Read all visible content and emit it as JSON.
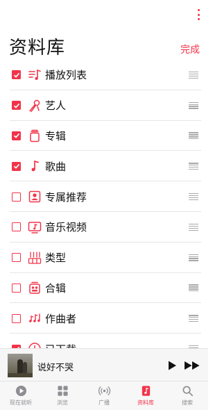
{
  "header": {
    "title": "资料库",
    "done_label": "完成",
    "more_icon": "more-vertical-icon"
  },
  "colors": {
    "accent": "#f2334a",
    "separator": "#e6e6e6",
    "handle": "#a8a8a8"
  },
  "library_items": [
    {
      "label": "播放列表",
      "checked": true,
      "icon": "playlist-icon"
    },
    {
      "label": "艺人",
      "checked": true,
      "icon": "microphone-icon"
    },
    {
      "label": "专辑",
      "checked": true,
      "icon": "album-stack-icon"
    },
    {
      "label": "歌曲",
      "checked": true,
      "icon": "music-note-icon"
    },
    {
      "label": "专属推荐",
      "checked": false,
      "icon": "person-square-icon"
    },
    {
      "label": "音乐视频",
      "checked": false,
      "icon": "tv-music-icon"
    },
    {
      "label": "类型",
      "checked": false,
      "icon": "genre-icon"
    },
    {
      "label": "合辑",
      "checked": false,
      "icon": "compilation-icon"
    },
    {
      "label": "作曲者",
      "checked": false,
      "icon": "composer-notes-icon"
    },
    {
      "label": "已下载",
      "checked": true,
      "icon": "download-circle-icon"
    }
  ],
  "now_playing": {
    "song_title": "说好不哭",
    "play_icon": "play-icon",
    "next_icon": "forward-icon"
  },
  "tabs": [
    {
      "label": "现在就听",
      "icon": "play-circle-icon",
      "active": false
    },
    {
      "label": "浏览",
      "icon": "grid-icon",
      "active": false
    },
    {
      "label": "广播",
      "icon": "radio-waves-icon",
      "active": false
    },
    {
      "label": "资料库",
      "icon": "library-note-icon",
      "active": true
    },
    {
      "label": "搜索",
      "icon": "search-icon",
      "active": false
    }
  ]
}
